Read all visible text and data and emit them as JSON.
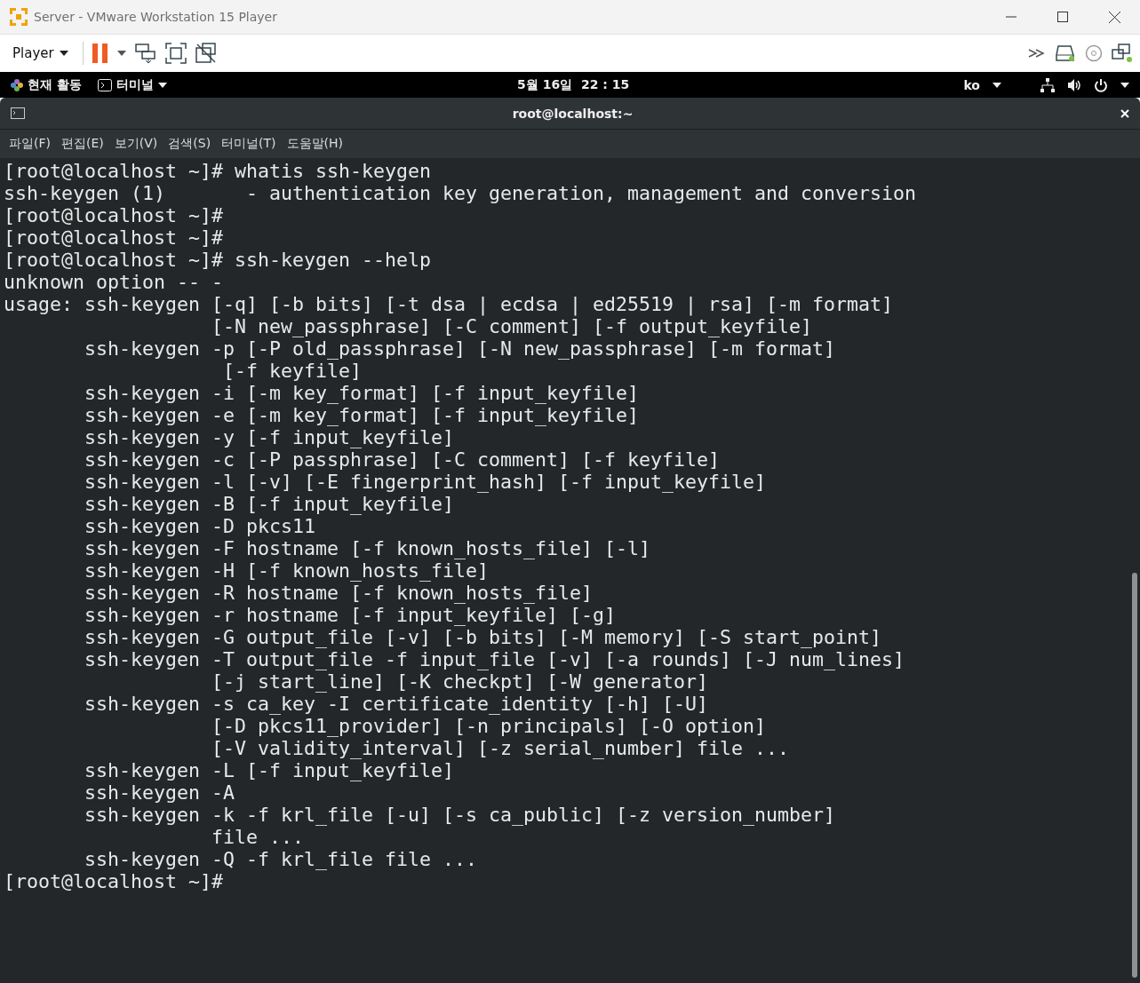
{
  "window": {
    "title": "Server - VMware Workstation 15 Player"
  },
  "toolbar": {
    "player_menu": "Player"
  },
  "top_bar": {
    "activities": "현재 활동",
    "app_menu": "터미널",
    "clock": "5월 16일  22 : 15",
    "input_source": "ko"
  },
  "terminal": {
    "title": "root@localhost:~",
    "menu": [
      "파일(F)",
      "편집(E)",
      "보기(V)",
      "검색(S)",
      "터미널(T)",
      "도움말(H)"
    ],
    "lines": [
      "[root@localhost ~]# whatis ssh-keygen",
      "ssh-keygen (1)       - authentication key generation, management and conversion",
      "[root@localhost ~]#",
      "[root@localhost ~]#",
      "[root@localhost ~]# ssh-keygen --help",
      "unknown option -- -",
      "usage: ssh-keygen [-q] [-b bits] [-t dsa | ecdsa | ed25519 | rsa] [-m format]",
      "                  [-N new_passphrase] [-C comment] [-f output_keyfile]",
      "       ssh-keygen -p [-P old_passphrase] [-N new_passphrase] [-m format]",
      "                   [-f keyfile]",
      "       ssh-keygen -i [-m key_format] [-f input_keyfile]",
      "       ssh-keygen -e [-m key_format] [-f input_keyfile]",
      "       ssh-keygen -y [-f input_keyfile]",
      "       ssh-keygen -c [-P passphrase] [-C comment] [-f keyfile]",
      "       ssh-keygen -l [-v] [-E fingerprint_hash] [-f input_keyfile]",
      "       ssh-keygen -B [-f input_keyfile]",
      "       ssh-keygen -D pkcs11",
      "       ssh-keygen -F hostname [-f known_hosts_file] [-l]",
      "       ssh-keygen -H [-f known_hosts_file]",
      "       ssh-keygen -R hostname [-f known_hosts_file]",
      "       ssh-keygen -r hostname [-f input_keyfile] [-g]",
      "       ssh-keygen -G output_file [-v] [-b bits] [-M memory] [-S start_point]",
      "       ssh-keygen -T output_file -f input_file [-v] [-a rounds] [-J num_lines]",
      "                  [-j start_line] [-K checkpt] [-W generator]",
      "       ssh-keygen -s ca_key -I certificate_identity [-h] [-U]",
      "                  [-D pkcs11_provider] [-n principals] [-O option]",
      "                  [-V validity_interval] [-z serial_number] file ...",
      "       ssh-keygen -L [-f input_keyfile]",
      "       ssh-keygen -A",
      "       ssh-keygen -k -f krl_file [-u] [-s ca_public] [-z version_number]",
      "                  file ...",
      "       ssh-keygen -Q -f krl_file file ...",
      "[root@localhost ~]#"
    ]
  }
}
